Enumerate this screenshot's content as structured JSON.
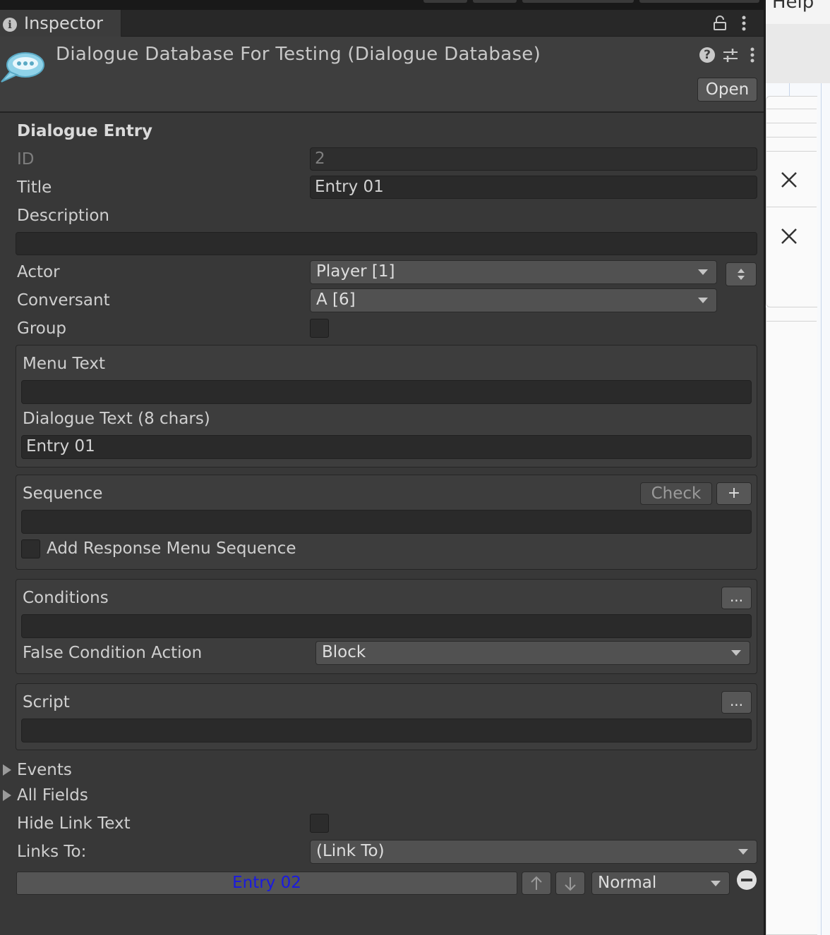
{
  "menu": {
    "help_label": "Help"
  },
  "tab": {
    "label": "Inspector",
    "icon": "info-icon"
  },
  "header": {
    "title": "Dialogue Database For Testing (Dialogue Database)",
    "icon": "chat-bubbles-icon",
    "open_label": "Open"
  },
  "entry": {
    "section_title": "Dialogue Entry",
    "id_label": "ID",
    "id_value": "2",
    "title_label": "Title",
    "title_value": "Entry 01",
    "description_label": "Description",
    "description_value": "",
    "actor_label": "Actor",
    "actor_value": "Player [1]",
    "conversant_label": "Conversant",
    "conversant_value": "A [6]",
    "group_label": "Group"
  },
  "text_box": {
    "menu_text_label": "Menu Text",
    "menu_text_value": "",
    "dialogue_text_label": "Dialogue Text (8 chars)",
    "dialogue_text_value": "Entry 01"
  },
  "sequence_box": {
    "label": "Sequence",
    "check_label": "Check",
    "plus_label": "+",
    "value": "",
    "add_response_label": "Add Response Menu Sequence"
  },
  "conditions_box": {
    "label": "Conditions",
    "more_label": "...",
    "value": "",
    "false_action_label": "False Condition Action",
    "false_action_value": "Block"
  },
  "script_box": {
    "label": "Script",
    "more_label": "...",
    "value": ""
  },
  "foldouts": {
    "events_label": "Events",
    "all_fields_label": "All Fields"
  },
  "links": {
    "hide_link_text_label": "Hide Link Text",
    "links_to_label": "Links To:",
    "links_to_value": "(Link To)",
    "link_entry_label": "Entry 02",
    "priority_value": "Normal",
    "link_color": "#1a1ae0"
  }
}
